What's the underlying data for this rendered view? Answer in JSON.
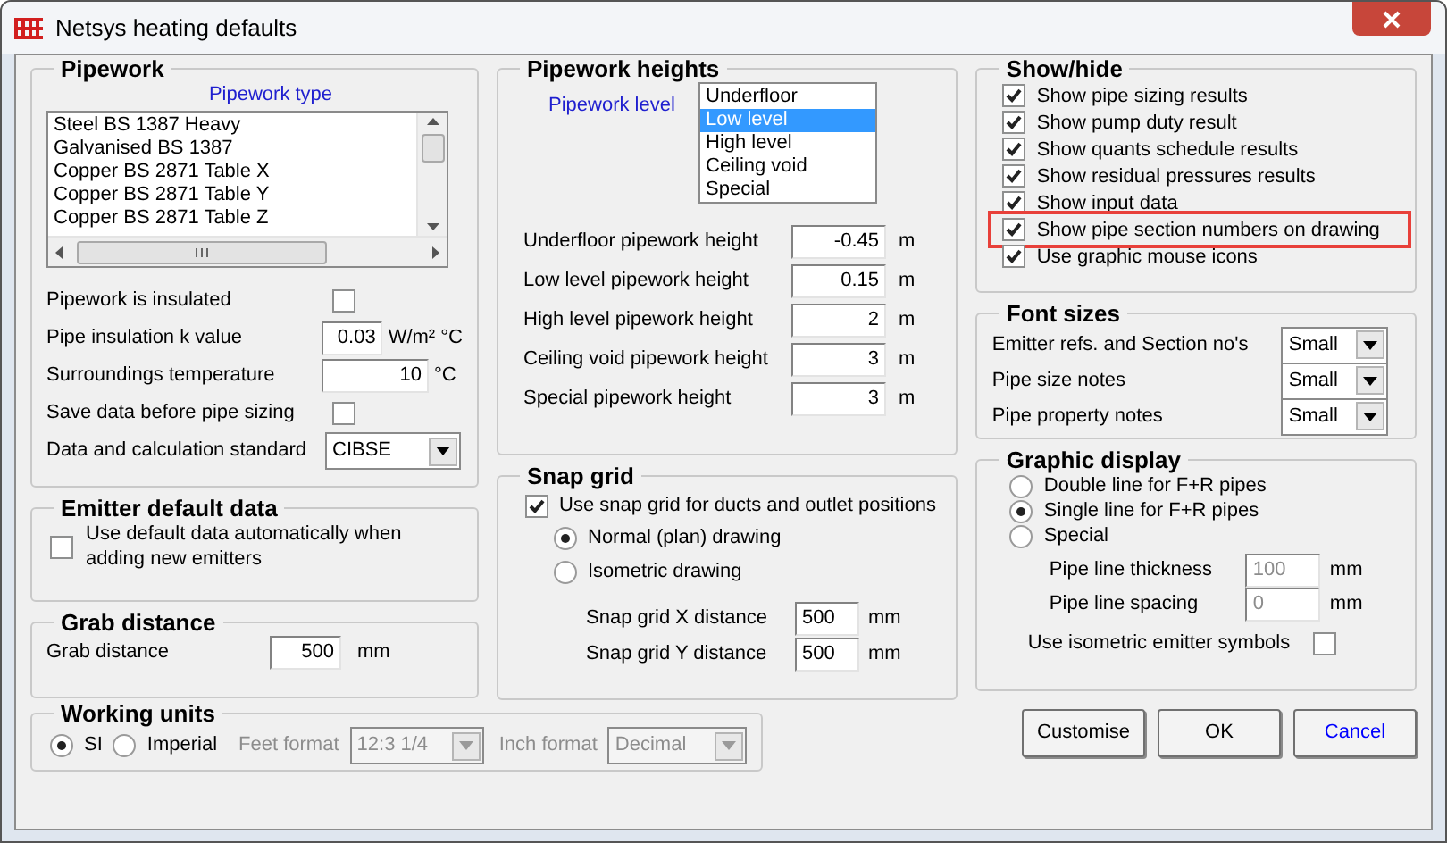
{
  "window": {
    "title": "Netsys heating defaults"
  },
  "pipework": {
    "title": "Pipework",
    "list_label": "Pipework type",
    "types": [
      "Steel BS 1387 Heavy",
      "Galvanised BS 1387",
      "Copper BS 2871 Table X",
      "Copper BS 2871 Table Y",
      "Copper BS 2871 Table Z"
    ],
    "rows": [
      {
        "kind": "checkbox",
        "label": "Pipework is insulated",
        "checked": false
      },
      {
        "kind": "number",
        "label": "Pipe insulation k value",
        "value": "0.03",
        "unit": "W/m² °C"
      },
      {
        "kind": "number",
        "label": "Surroundings temperature",
        "value": "10",
        "unit": "°C"
      },
      {
        "kind": "checkbox",
        "label": "Save data before pipe sizing",
        "checked": false
      },
      {
        "kind": "dropdown",
        "label": "Data and calculation standard",
        "value": "CIBSE"
      }
    ]
  },
  "emitter_default_data": {
    "title": "Emitter default data",
    "option": {
      "label": "Use default data automatically when adding new emitters",
      "checked": false
    }
  },
  "grab_distance": {
    "title": "Grab distance",
    "label": "Grab distance",
    "value": "500",
    "unit": "mm"
  },
  "working_units": {
    "title": "Working units",
    "systems": [
      {
        "label": "SI",
        "selected": true
      },
      {
        "label": "Imperial",
        "selected": false
      }
    ],
    "feet_format": {
      "label": "Feet format",
      "value": "12:3 1/4",
      "disabled": true
    },
    "inch_format": {
      "label": "Inch format",
      "value": "Decimal",
      "disabled": true
    }
  },
  "pipework_heights": {
    "title": "Pipework heights",
    "level_label": "Pipework level",
    "levels": [
      {
        "label": "Underfloor",
        "selected": false
      },
      {
        "label": "Low level",
        "selected": true
      },
      {
        "label": "High level",
        "selected": false
      },
      {
        "label": "Ceiling void",
        "selected": false
      },
      {
        "label": "Special",
        "selected": false
      }
    ],
    "rows": [
      {
        "label": "Underfloor pipework height",
        "value": "-0.45",
        "unit": "m"
      },
      {
        "label": "Low level pipework height",
        "value": "0.15",
        "unit": "m"
      },
      {
        "label": "High level pipework height",
        "value": "2",
        "unit": "m"
      },
      {
        "label": "Ceiling void pipework height",
        "value": "3",
        "unit": "m"
      },
      {
        "label": "Special pipework height",
        "value": "3",
        "unit": "m"
      }
    ]
  },
  "snap_grid": {
    "title": "Snap grid",
    "enable": {
      "label": "Use snap grid for ducts and outlet positions",
      "checked": true
    },
    "modes": [
      {
        "label": "Normal (plan) drawing",
        "selected": true
      },
      {
        "label": "Isometric drawing",
        "selected": false
      }
    ],
    "rows": [
      {
        "label": "Snap grid X distance",
        "value": "500",
        "unit": "mm"
      },
      {
        "label": "Snap grid Y distance",
        "value": "500",
        "unit": "mm"
      }
    ]
  },
  "show_hide": {
    "title": "Show/hide",
    "options": [
      {
        "label": "Show pipe sizing results",
        "checked": true,
        "highlighted": false
      },
      {
        "label": "Show pump duty result",
        "checked": true,
        "highlighted": false
      },
      {
        "label": "Show quants schedule results",
        "checked": true,
        "highlighted": false
      },
      {
        "label": "Show residual pressures results",
        "checked": true,
        "highlighted": false
      },
      {
        "label": "Show input data",
        "checked": true,
        "highlighted": false
      },
      {
        "label": "Show pipe section numbers on drawing",
        "checked": true,
        "highlighted": true
      },
      {
        "label": "Use graphic mouse icons",
        "checked": true,
        "highlighted": false
      }
    ]
  },
  "font_sizes": {
    "title": "Font sizes",
    "rows": [
      {
        "label": "Emitter refs. and Section no's",
        "value": "Small"
      },
      {
        "label": "Pipe size notes",
        "value": "Small"
      },
      {
        "label": "Pipe property notes",
        "value": "Small"
      }
    ]
  },
  "graphic_display": {
    "title": "Graphic display",
    "modes": [
      {
        "label": "Double line for F+R pipes",
        "selected": false
      },
      {
        "label": "Single line for F+R pipes",
        "selected": true
      },
      {
        "label": "Special",
        "selected": false
      }
    ],
    "rows": [
      {
        "label": "Pipe line thickness",
        "value": "100",
        "unit": "mm",
        "disabled": true
      },
      {
        "label": "Pipe line spacing",
        "value": "0",
        "unit": "mm",
        "disabled": true
      }
    ],
    "iso_symbols": {
      "label": "Use isometric emitter symbols",
      "checked": false
    }
  },
  "buttons": [
    {
      "label": "Customise",
      "color": "#000000"
    },
    {
      "label": "OK",
      "color": "#000000"
    },
    {
      "label": "Cancel",
      "color": "#0000ff"
    }
  ]
}
